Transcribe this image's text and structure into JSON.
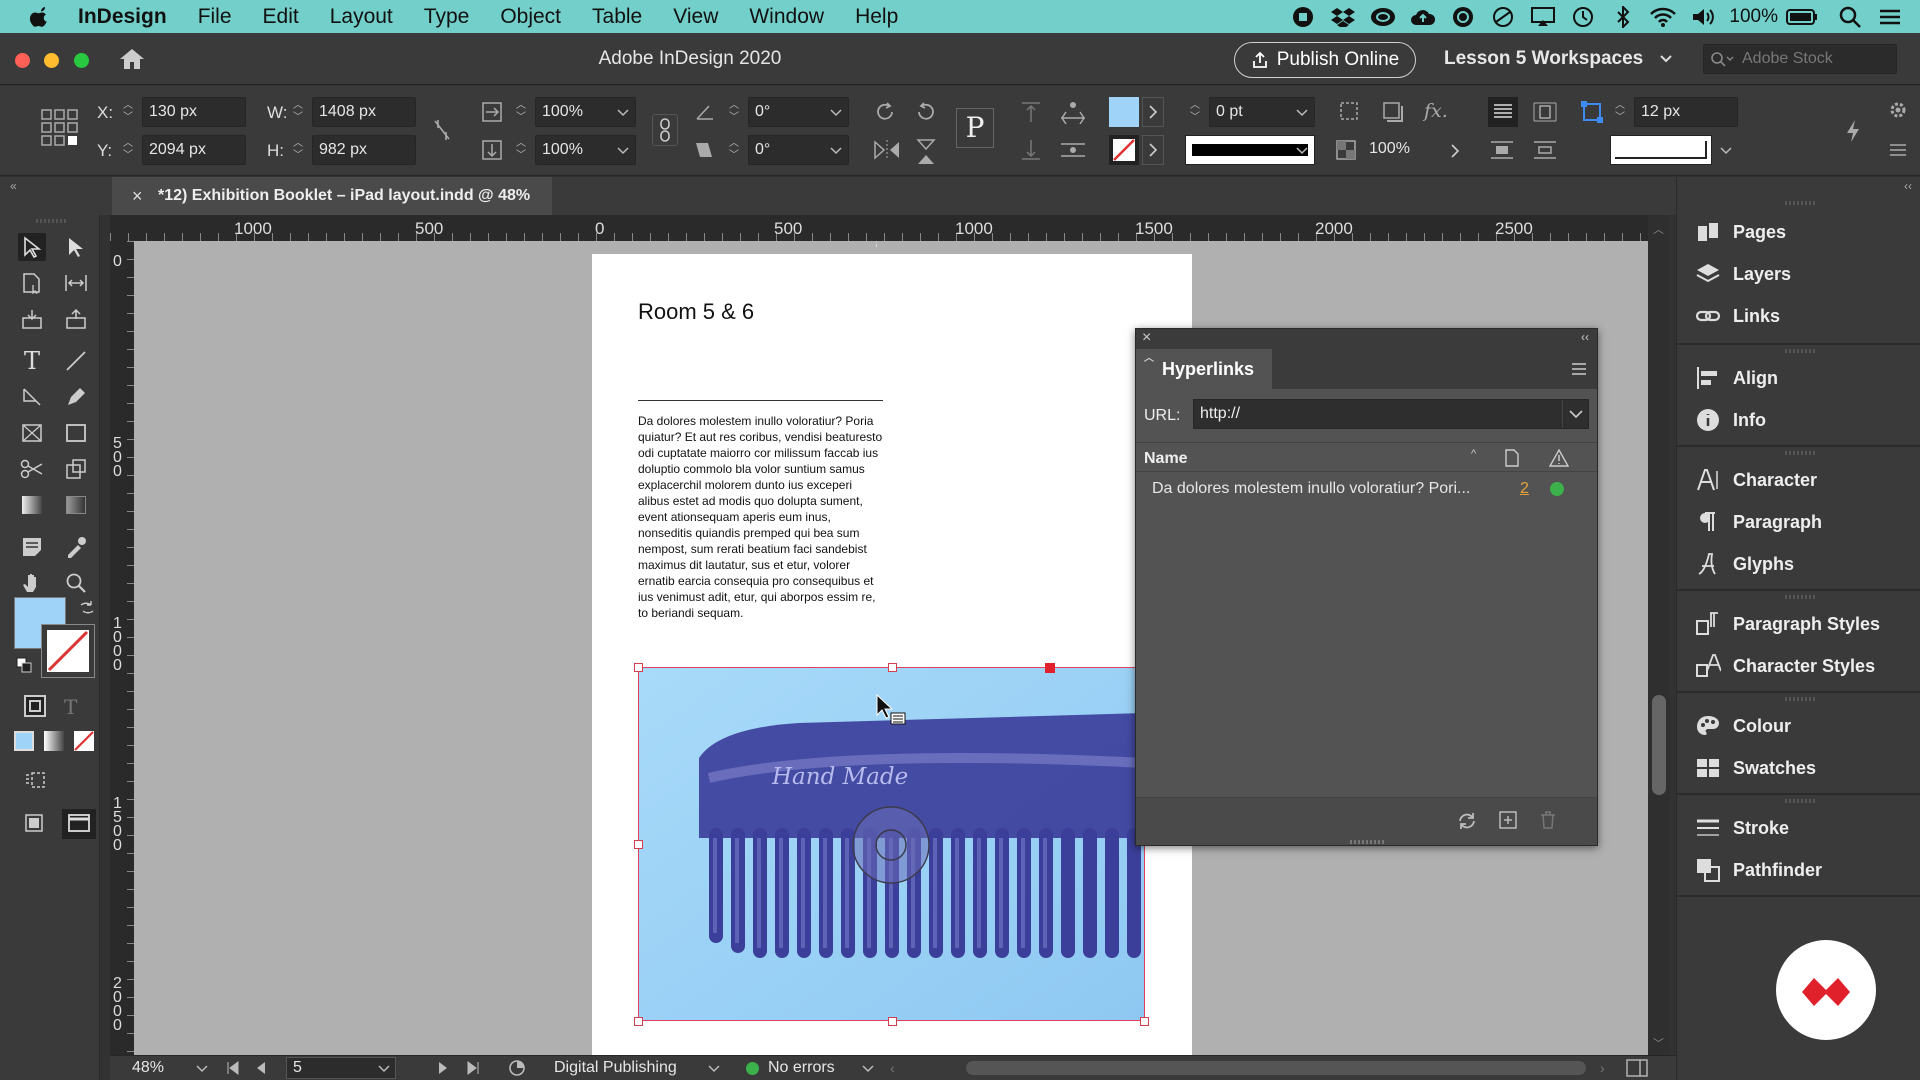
{
  "menubar": {
    "app": "InDesign",
    "items": [
      "File",
      "Edit",
      "Layout",
      "Type",
      "Object",
      "Table",
      "View",
      "Window",
      "Help"
    ],
    "battery": "100%"
  },
  "titlebar": {
    "title": "Adobe InDesign 2020",
    "publish": "Publish Online",
    "workspace": "Lesson 5 Workspaces",
    "stock_placeholder": "Adobe Stock"
  },
  "control": {
    "x_label": "X:",
    "x": "130 px",
    "y_label": "Y:",
    "y": "2094 px",
    "w_label": "W:",
    "w": "1408 px",
    "h_label": "H:",
    "h": "982 px",
    "scale_x": "100%",
    "scale_y": "100%",
    "rotate": "0°",
    "shear": "0°",
    "stroke_weight": "0 pt",
    "opacity": "100%",
    "gap": "12 px",
    "colors": {
      "fill": "#9fd3f7",
      "stroke_none": "#d33"
    }
  },
  "document": {
    "tab": "*12) Exhibition Booklet – iPad layout.indd @ 48%",
    "room_title": "Room 5 & 6",
    "body": "Da dolores molestem inullo voloratiur? Poria quiatur? Et aut res coribus, vendisi beaturesto odi cuptatate maiorro cor milissum faccab ius doluptio commolo bla volor suntium samus explacerchil molorem dunto ius exceperi alibus estet ad modis quo dolupta sument, event ationsequam aperis eum inus, nonseditis quiandis premped qui bea sum nempost, sum rerati beatium faci sandebist maximus dit lautatur, sus et etur, volorer ernatib earcia consequia pro consequibus et ius venimust adit, etur, qui aborpos essim re, to beriandi sequam.",
    "image_text": "Hand Made"
  },
  "hruler": [
    "1000",
    "500",
    "0",
    "500",
    "1000",
    "1500",
    "2000",
    "2500"
  ],
  "vruler": [
    "0",
    "5\n0\n0",
    "1\n0\n0\n0",
    "1\n5\n0\n0",
    "2\n0\n0\n0"
  ],
  "hyperlinks": {
    "title": "Hyperlinks",
    "url_label": "URL:",
    "url": "http://",
    "col_name": "Name",
    "rows": [
      {
        "name": "Da dolores molestem inullo voloratiur? Pori...",
        "page": "2"
      }
    ]
  },
  "panels": [
    "Pages",
    "Layers",
    "Links",
    "Align",
    "Info",
    "Character",
    "Paragraph",
    "Glyphs",
    "Paragraph Styles",
    "Character Styles",
    "Colour",
    "Swatches",
    "Stroke",
    "Pathfinder"
  ],
  "status": {
    "zoom": "48%",
    "page": "5",
    "mode": "Digital Publishing",
    "errors": "No errors"
  }
}
